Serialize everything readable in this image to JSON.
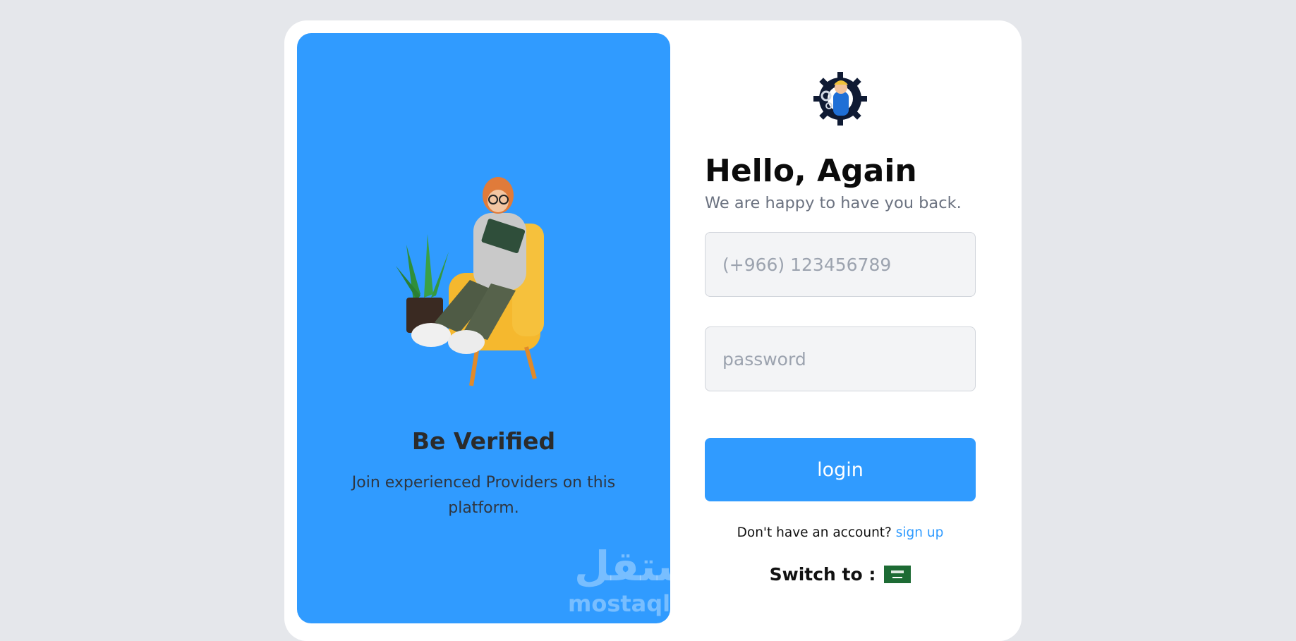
{
  "promo": {
    "title": "Be Verified",
    "subtitle": "Join experienced Providers on this platform."
  },
  "login": {
    "heading": "Hello, Again",
    "subheading": "We are happy to have you back.",
    "phone_placeholder": "(+966) 123456789",
    "password_placeholder": "password",
    "login_label": "login",
    "no_account_text": "Don't have an account?",
    "signup_label": "sign up",
    "switch_label": "Switch to :"
  },
  "icons": {
    "logo": "mechanic-gear-logo-icon",
    "flag": "saudi-flag-icon"
  },
  "watermark": {
    "arabic": "مستقل",
    "latin": "mostaql.com"
  },
  "colors": {
    "accent": "#309bff",
    "background": "#e5e7eb",
    "card": "#ffffff",
    "flag_green": "#1d6b34"
  }
}
